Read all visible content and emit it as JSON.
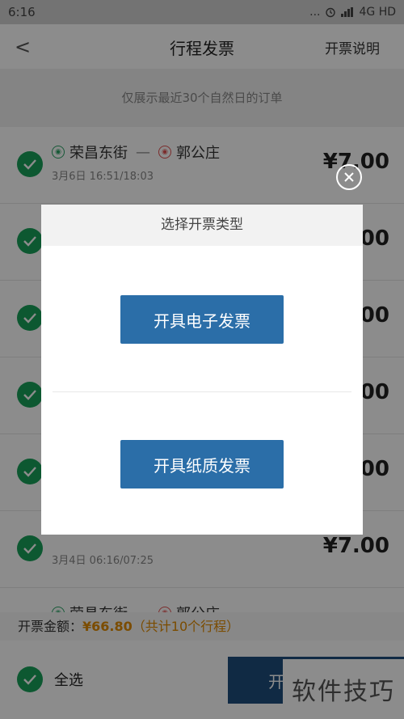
{
  "status_bar": {
    "time": "6:16",
    "dots": "...",
    "network": "4G HD"
  },
  "nav": {
    "back_glyph": "<",
    "title": "行程发票",
    "help": "开票说明"
  },
  "notice": "仅展示最近30个自然日的订单",
  "trips": [
    {
      "from": "荣昌东街",
      "to": "郭公庄",
      "time": "3月6日 16:51/18:03",
      "price": "¥7.00"
    },
    {
      "from": "",
      "to": "",
      "time": "",
      "price": "¥7.00"
    },
    {
      "from": "",
      "to": "",
      "time": "",
      "price": "¥7.00"
    },
    {
      "from": "",
      "to": "",
      "time": "",
      "price": "¥7.00"
    },
    {
      "from": "",
      "to": "",
      "time": "",
      "price": "¥7.00"
    },
    {
      "from": "",
      "to": "",
      "time": "3月4日 06:16/07:25",
      "price": "¥7.00"
    },
    {
      "from": "荣昌东街",
      "to": "郭公庄",
      "time": "",
      "price": ""
    }
  ],
  "footer": {
    "amount_label": "开票金额：",
    "amount_value": "¥66.80",
    "amount_count": "（共计10个行程）",
    "select_all": "全选",
    "primary_button": "开"
  },
  "modal": {
    "title": "选择开票类型",
    "electronic_button": "开具电子发票",
    "paper_button": "开具纸质发票"
  },
  "watermark": "软件技巧",
  "colors": {
    "accent_green": "#19a05a",
    "button_blue": "#2b6ea8",
    "dark_blue": "#1e4e7c",
    "amount_orange": "#e08a00"
  }
}
